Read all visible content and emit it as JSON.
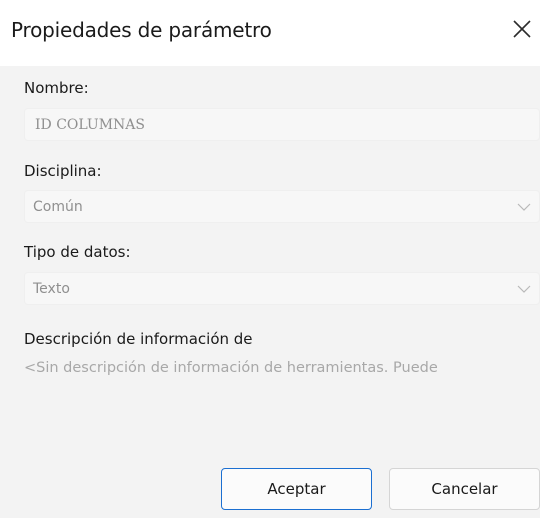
{
  "dialog": {
    "title": "Propiedades de parámetro",
    "close_icon": "close-icon"
  },
  "fields": {
    "nombre": {
      "label": "Nombre:",
      "value": "ID COLUMNAS"
    },
    "disciplina": {
      "label": "Disciplina:",
      "value": "Común",
      "icon": "chevron-down-icon"
    },
    "tipo": {
      "label": "Tipo de datos:",
      "value": "Texto",
      "icon": "chevron-down-icon"
    },
    "descripcion": {
      "label": "Descripción de información de",
      "placeholder": "<Sin descripción de información de herramientas. Puede"
    }
  },
  "buttons": {
    "accept_label": "Aceptar",
    "cancel_label": "Cancelar"
  },
  "colors": {
    "accent": "#1b6fd1",
    "body_bg": "#f3f3f3",
    "disabled_text": "#8f8f8f"
  }
}
